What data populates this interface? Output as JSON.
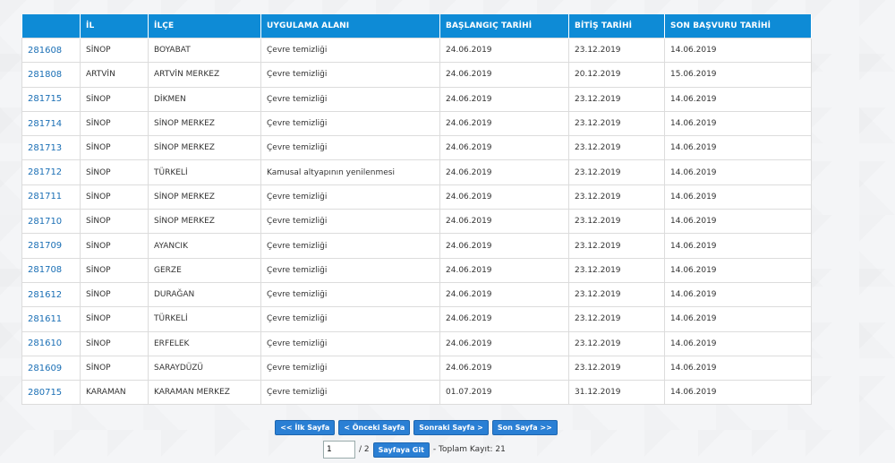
{
  "table": {
    "headers": [
      "",
      "İL",
      "İLÇE",
      "UYGULAMA ALANI",
      "BAŞLANGIÇ TARİHİ",
      "BİTİŞ TARİHİ",
      "SON BAŞVURU TARİHİ"
    ],
    "rows": [
      [
        "281608",
        "SİNOP",
        "BOYABAT",
        "Çevre temizliği",
        "24.06.2019",
        "23.12.2019",
        "14.06.2019"
      ],
      [
        "281808",
        "ARTVİN",
        "ARTVİN MERKEZ",
        "Çevre temizliği",
        "24.06.2019",
        "20.12.2019",
        "15.06.2019"
      ],
      [
        "281715",
        "SİNOP",
        "DİKMEN",
        "Çevre temizliği",
        "24.06.2019",
        "23.12.2019",
        "14.06.2019"
      ],
      [
        "281714",
        "SİNOP",
        "SİNOP MERKEZ",
        "Çevre temizliği",
        "24.06.2019",
        "23.12.2019",
        "14.06.2019"
      ],
      [
        "281713",
        "SİNOP",
        "SİNOP MERKEZ",
        "Çevre temizliği",
        "24.06.2019",
        "23.12.2019",
        "14.06.2019"
      ],
      [
        "281712",
        "SİNOP",
        "TÜRKELİ",
        "Kamusal altyapının yenilenmesi",
        "24.06.2019",
        "23.12.2019",
        "14.06.2019"
      ],
      [
        "281711",
        "SİNOP",
        "SİNOP MERKEZ",
        "Çevre temizliği",
        "24.06.2019",
        "23.12.2019",
        "14.06.2019"
      ],
      [
        "281710",
        "SİNOP",
        "SİNOP MERKEZ",
        "Çevre temizliği",
        "24.06.2019",
        "23.12.2019",
        "14.06.2019"
      ],
      [
        "281709",
        "SİNOP",
        "AYANCIK",
        "Çevre temizliği",
        "24.06.2019",
        "23.12.2019",
        "14.06.2019"
      ],
      [
        "281708",
        "SİNOP",
        "GERZE",
        "Çevre temizliği",
        "24.06.2019",
        "23.12.2019",
        "14.06.2019"
      ],
      [
        "281612",
        "SİNOP",
        "DURAĞAN",
        "Çevre temizliği",
        "24.06.2019",
        "23.12.2019",
        "14.06.2019"
      ],
      [
        "281611",
        "SİNOP",
        "TÜRKELİ",
        "Çevre temizliği",
        "24.06.2019",
        "23.12.2019",
        "14.06.2019"
      ],
      [
        "281610",
        "SİNOP",
        "ERFELEK",
        "Çevre temizliği",
        "24.06.2019",
        "23.12.2019",
        "14.06.2019"
      ],
      [
        "281609",
        "SİNOP",
        "SARAYDÜZÜ",
        "Çevre temizliği",
        "24.06.2019",
        "23.12.2019",
        "14.06.2019"
      ],
      [
        "280715",
        "KARAMAN",
        "KARAMAN MERKEZ",
        "Çevre temizliği",
        "01.07.2019",
        "31.12.2019",
        "14.06.2019"
      ]
    ]
  },
  "pager": {
    "first_label": "<< İlk Sayfa",
    "prev_label": "< Önceki Sayfa",
    "next_label": "Sonraki Sayfa >",
    "last_label": "Son Sayfa >>",
    "page_value": "1",
    "total_pages_text": "/ 2",
    "go_label": "Sayfaya Git",
    "total_records_text": "- Toplam Kayıt: 21"
  }
}
